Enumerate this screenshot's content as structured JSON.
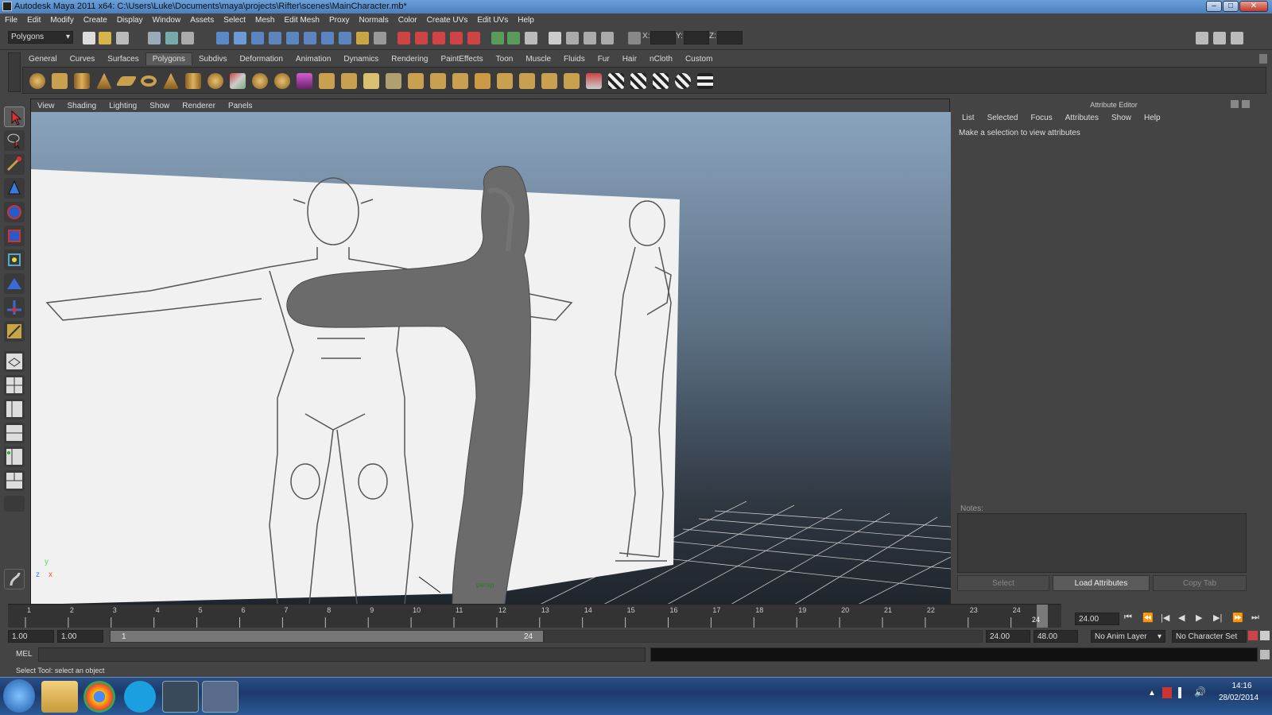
{
  "window": {
    "title": "Autodesk Maya 2011 x64: C:\\Users\\Luke\\Documents\\maya\\projects\\Rifter\\scenes\\MainCharacter.mb*"
  },
  "menubar": [
    "File",
    "Edit",
    "Modify",
    "Create",
    "Display",
    "Window",
    "Assets",
    "Select",
    "Mesh",
    "Edit Mesh",
    "Proxy",
    "Normals",
    "Color",
    "Create UVs",
    "Edit UVs",
    "Help"
  ],
  "statusline": {
    "mode": "Polygons",
    "x_label": "X:",
    "y_label": "Y:",
    "z_label": "Z:"
  },
  "shelf_tabs": [
    "General",
    "Curves",
    "Surfaces",
    "Polygons",
    "Subdivs",
    "Deformation",
    "Animation",
    "Dynamics",
    "Rendering",
    "PaintEffects",
    "Toon",
    "Muscle",
    "Fluids",
    "Fur",
    "Hair",
    "nCloth",
    "Custom"
  ],
  "shelf_active": "Polygons",
  "panel_menu": [
    "View",
    "Shading",
    "Lighting",
    "Show",
    "Renderer",
    "Panels"
  ],
  "viewport": {
    "camera_label": "persp",
    "axis_y": "y",
    "axis_z": "z",
    "axis_x": "x"
  },
  "attribute_editor": {
    "title": "Attribute Editor",
    "menu": [
      "List",
      "Selected",
      "Focus",
      "Attributes",
      "Show",
      "Help"
    ],
    "message": "Make a selection to view attributes",
    "notes_label": "Notes:",
    "buttons": {
      "select": "Select",
      "load": "Load Attributes",
      "copy": "Copy Tab"
    }
  },
  "timeline": {
    "ticks": [
      "1",
      "2",
      "3",
      "4",
      "5",
      "6",
      "7",
      "8",
      "9",
      "10",
      "11",
      "12",
      "13",
      "14",
      "15",
      "16",
      "17",
      "18",
      "19",
      "20",
      "21",
      "22",
      "23",
      "24"
    ],
    "current_frame_label": "24",
    "current_time": "24.00"
  },
  "range": {
    "start": "1.00",
    "playback_start": "1.00",
    "slider_start": "1",
    "slider_end": "24",
    "playback_end": "24.00",
    "end": "48.00",
    "anim_layer": "No Anim Layer",
    "character_set": "No Character Set"
  },
  "command_line": {
    "label": "MEL"
  },
  "help_line": "Select Tool: select an object",
  "taskbar": {
    "time": "14:16",
    "date": "28/02/2014"
  },
  "colors": {
    "titlebar": "#5b8fcc",
    "ui_bg": "#444444",
    "taskbar": "#1f3f73"
  }
}
